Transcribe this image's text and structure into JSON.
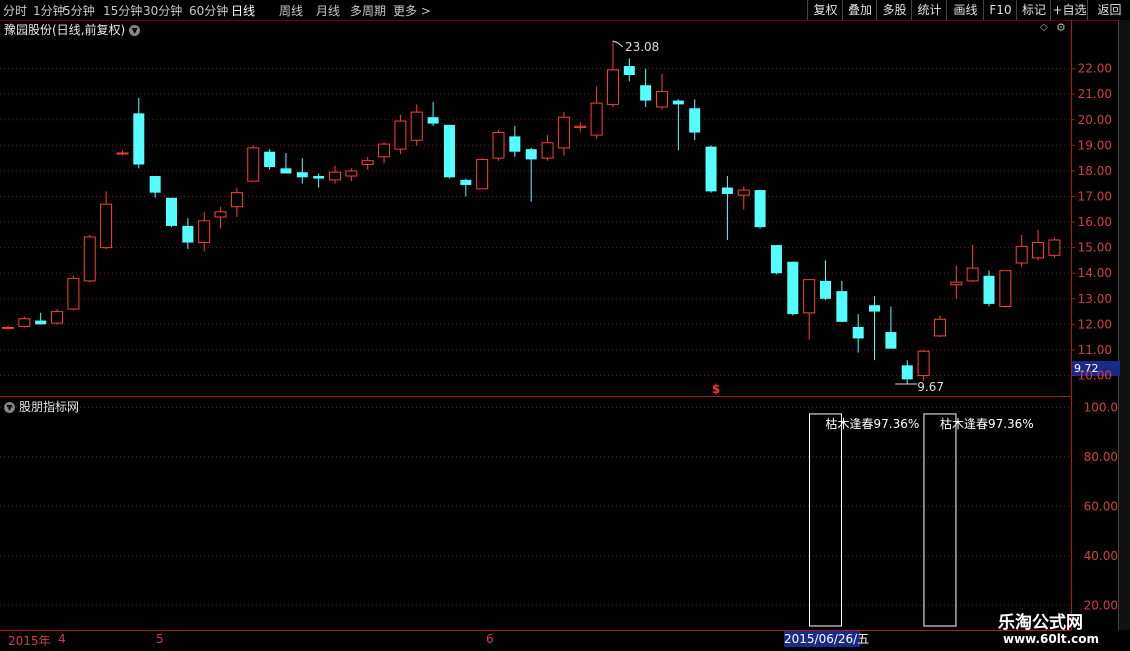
{
  "toolbar": {
    "left_items": [
      "分时",
      "1分钟",
      "5分钟",
      "15分钟",
      "30分钟",
      "60分钟",
      "日线",
      "周线",
      "月线",
      "多周期",
      "更多 >"
    ],
    "active": "日线",
    "right_items": [
      "复权",
      "叠加",
      "多股",
      "统计",
      "画线",
      "F10",
      "标记",
      "+自选",
      "返回"
    ]
  },
  "main_title": "豫园股份(日线,前复权)",
  "sub_title": "股朋指标网",
  "price_badge": "9.72",
  "watermark": {
    "line1": "乐淘公式网",
    "line2": "www.60lt.com"
  },
  "dates": {
    "year": "2015年",
    "m4": "4",
    "m5": "5",
    "m6": "6",
    "highlight": "2015/06/26/五"
  },
  "chart_data": [
    {
      "type": "candlestick",
      "title": "豫园股份(日线,前复权)",
      "ylim": [
        9.2,
        23.9
      ],
      "y_ticks": [
        "22.00",
        "21.00",
        "20.00",
        "19.00",
        "18.00",
        "17.00",
        "16.00",
        "15.00",
        "14.00",
        "13.00",
        "12.00",
        "11.00",
        "10.00"
      ],
      "up_color": "#ff3c3c",
      "down_color": "#54ffff",
      "annotations": {
        "high": "23.08",
        "low": "9.67",
        "marker": "$"
      },
      "candles": [
        [
          11.85,
          11.95,
          11.8,
          11.88
        ],
        [
          11.92,
          12.3,
          11.88,
          12.22
        ],
        [
          12.15,
          12.45,
          12.02,
          12.0
        ],
        [
          12.05,
          12.6,
          12.0,
          12.5
        ],
        [
          12.6,
          13.9,
          12.55,
          13.8
        ],
        [
          13.7,
          15.5,
          13.65,
          15.42
        ],
        [
          15.0,
          17.2,
          14.95,
          16.7
        ],
        [
          18.7,
          18.8,
          18.6,
          18.7
        ],
        [
          20.25,
          20.85,
          18.1,
          18.25
        ],
        [
          17.8,
          17.8,
          16.95,
          17.15
        ],
        [
          16.95,
          16.95,
          15.8,
          15.85
        ],
        [
          15.85,
          16.15,
          14.95,
          15.2
        ],
        [
          15.2,
          16.4,
          14.85,
          16.05
        ],
        [
          16.2,
          16.6,
          15.75,
          16.4
        ],
        [
          16.6,
          17.35,
          16.2,
          17.15
        ],
        [
          17.6,
          19.0,
          17.6,
          18.9
        ],
        [
          18.75,
          18.85,
          18.05,
          18.15
        ],
        [
          18.1,
          18.7,
          17.95,
          17.9
        ],
        [
          17.95,
          18.5,
          17.5,
          17.75
        ],
        [
          17.8,
          17.9,
          17.35,
          17.7
        ],
        [
          17.65,
          18.2,
          17.5,
          17.95
        ],
        [
          17.8,
          18.1,
          17.6,
          18.0
        ],
        [
          18.25,
          18.55,
          18.05,
          18.4
        ],
        [
          18.55,
          19.1,
          18.3,
          19.05
        ],
        [
          18.85,
          20.2,
          18.65,
          19.95
        ],
        [
          19.2,
          20.6,
          19.0,
          20.3
        ],
        [
          20.1,
          20.7,
          19.75,
          19.85
        ],
        [
          19.8,
          19.8,
          17.7,
          17.75
        ],
        [
          17.65,
          17.7,
          17.0,
          17.45
        ],
        [
          17.3,
          18.5,
          17.3,
          18.45
        ],
        [
          18.5,
          19.6,
          18.4,
          19.5
        ],
        [
          19.35,
          19.75,
          18.55,
          18.75
        ],
        [
          18.85,
          18.9,
          16.8,
          18.45
        ],
        [
          18.5,
          19.4,
          18.4,
          19.1
        ],
        [
          18.9,
          20.3,
          18.6,
          20.1
        ],
        [
          19.7,
          19.9,
          19.55,
          19.75
        ],
        [
          19.4,
          21.3,
          19.25,
          20.65
        ],
        [
          20.6,
          23.08,
          20.5,
          21.95
        ],
        [
          22.1,
          22.4,
          21.5,
          21.75
        ],
        [
          21.35,
          22.0,
          20.5,
          20.75
        ],
        [
          20.5,
          21.8,
          20.4,
          21.1
        ],
        [
          20.75,
          20.8,
          18.8,
          20.6
        ],
        [
          20.45,
          20.8,
          19.2,
          19.5
        ],
        [
          18.95,
          19.0,
          17.15,
          17.2
        ],
        [
          17.35,
          17.8,
          15.3,
          17.1
        ],
        [
          17.05,
          17.4,
          16.5,
          17.25
        ],
        [
          17.25,
          17.25,
          15.75,
          15.8
        ],
        [
          15.1,
          15.1,
          13.95,
          14.0
        ],
        [
          14.45,
          14.45,
          12.35,
          12.4
        ],
        [
          12.45,
          13.7,
          11.4,
          13.75
        ],
        [
          13.7,
          14.5,
          12.95,
          13.0
        ],
        [
          13.3,
          13.7,
          12.1,
          12.1
        ],
        [
          11.9,
          12.4,
          10.9,
          11.45
        ],
        [
          12.75,
          13.1,
          10.6,
          12.5
        ],
        [
          11.7,
          12.7,
          11.05,
          11.05
        ],
        [
          10.4,
          10.6,
          9.67,
          9.85
        ],
        [
          10.0,
          11.0,
          9.8,
          10.95
        ],
        [
          11.55,
          12.35,
          11.5,
          12.2
        ],
        [
          13.55,
          14.3,
          13.0,
          13.65
        ],
        [
          13.7,
          15.1,
          13.65,
          14.2
        ],
        [
          13.9,
          14.1,
          12.7,
          12.8
        ],
        [
          12.7,
          14.1,
          12.65,
          14.1
        ],
        [
          14.4,
          15.5,
          14.25,
          15.05
        ],
        [
          14.6,
          15.7,
          14.5,
          15.2
        ],
        [
          14.7,
          15.4,
          14.6,
          15.3
        ]
      ]
    },
    {
      "type": "bar",
      "title": "股朋指标网",
      "ylim": [
        10,
        103
      ],
      "y_ticks": [
        "100.0",
        "80.00",
        "60.00",
        "40.00",
        "20.00"
      ],
      "bar_labels": [
        "枯木逢春97.36%",
        "枯木逢春97.36%"
      ],
      "values": [
        97.36,
        97.36
      ],
      "bar_candle_index": [
        50,
        57
      ]
    }
  ]
}
